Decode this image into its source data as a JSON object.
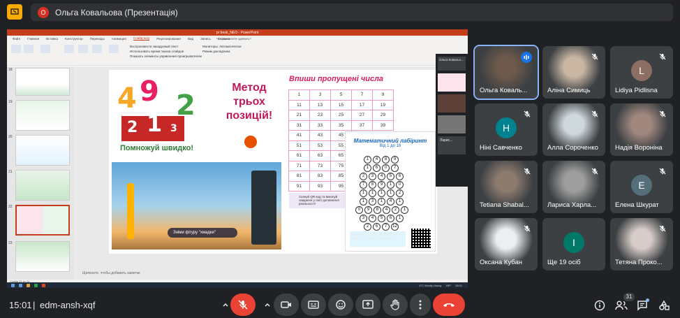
{
  "presenter": {
    "initial": "О",
    "title": "Ольга Ковальова (Презентація)"
  },
  "ppt": {
    "window_title": "pr book_NEO - PowerPoint",
    "tabs": [
      "Файл",
      "Главная",
      "Вставка",
      "Конструктор",
      "Переходы",
      "Анимация",
      "Слайд-шоу",
      "Рецензирование",
      "Вид",
      "Запись",
      "Справка"
    ],
    "active_tab": "Слайд-шоу",
    "search_placeholder": "Что вы хотите сделать?",
    "ribbon_checks": [
      "Воспроизвести закадровый текст",
      "Использовать время показа слайдов",
      "Показать элементы управления проигрывателем"
    ],
    "ribbon_monitor": "Мониторы:",
    "ribbon_monitor_value": "Автоматически",
    "ribbon_presenter_mode": "Режим докладчика",
    "thumb_numbers": [
      "18",
      "19",
      "20",
      "21",
      "22",
      "23"
    ],
    "notes_placeholder": "Щелкните, чтобы добавить заметки",
    "status_left": "Слайд 22 из 24",
    "weather": "4°C  Mostly cloudy",
    "lang": "УКР",
    "time": "15:01",
    "date": "26.11.2024"
  },
  "slide": {
    "metod": [
      "Метод",
      "трьох",
      "позицій!"
    ],
    "pomnozh": "Помножуй швидко!",
    "vpyshy_title": "Впиши пропущені числа",
    "grid": [
      [
        "1",
        "3",
        "5",
        "7",
        "9"
      ],
      [
        "11",
        "13",
        "15",
        "17",
        "19"
      ],
      [
        "21",
        "23",
        "25",
        "27",
        "29"
      ],
      [
        "31",
        "33",
        "35",
        "37",
        "39"
      ],
      [
        "41",
        "43",
        "45",
        "",
        ""
      ],
      [
        "51",
        "53",
        "55",
        "",
        ""
      ],
      [
        "61",
        "63",
        "65",
        "",
        ""
      ],
      [
        "71",
        "73",
        "75",
        "",
        ""
      ],
      [
        "81",
        "83",
        "85",
        "",
        ""
      ],
      [
        "91",
        "93",
        "95",
        "",
        ""
      ]
    ],
    "maze_title": "Математичний лабіринт",
    "maze_sub": "Від 1 до 16",
    "maze_rows": [
      [
        "1",
        "4",
        "8",
        "9"
      ],
      [
        "1",
        "6",
        "0",
        "7"
      ],
      [
        "2",
        "3",
        "4",
        "5",
        "6"
      ],
      [
        "7",
        "8",
        "9",
        "1",
        "0"
      ],
      [
        "1",
        "1",
        "1",
        "1",
        "2"
      ],
      [
        "1",
        "3",
        "1",
        "4",
        "1"
      ],
      [
        "0",
        "9",
        "8",
        "4",
        "2",
        "1"
      ],
      [
        "3",
        "4",
        "5",
        "6",
        "1"
      ],
      [
        "2",
        "6",
        "7",
        "12"
      ]
    ],
    "qr_text": "Скануй QR-код та виконуй завдання у світі доповненої реальності!",
    "game_caption": "Зніми фігуру \"хмадки\""
  },
  "mini_panel": {
    "name": "Ольга Ковальо...",
    "tile2": "Ларис..."
  },
  "tiles": [
    {
      "name": "Ольга Коваль...",
      "speaking": true
    },
    {
      "name": "Аліна Симиць",
      "muted": true
    },
    {
      "name": "Lidiya Pidlisna",
      "initial": "L",
      "color": "#8d6e63",
      "muted": true
    },
    {
      "name": "Ніні Савченко",
      "initial": "H",
      "color": "#00838f",
      "muted": true
    },
    {
      "name": "Алла Сороченко",
      "muted": true
    },
    {
      "name": "Надія Вороніна",
      "muted": true
    },
    {
      "name": "Tetiana Shabal...",
      "muted": true
    },
    {
      "name": "Лариса Харла...",
      "muted": true
    },
    {
      "name": "Елена Шкурат",
      "initial": "E",
      "color": "#546e7a",
      "muted": true
    },
    {
      "name": "Оксана Кубан",
      "muted": true
    },
    {
      "name": "Ще 19 осіб",
      "initial": "І",
      "color": "#00796b"
    },
    {
      "name": "Тетяна Проко...",
      "muted": true
    }
  ],
  "bottom": {
    "time": "15:01",
    "separator": "|",
    "meeting_code": "edm-ansh-xqf",
    "participants_count": "31"
  }
}
